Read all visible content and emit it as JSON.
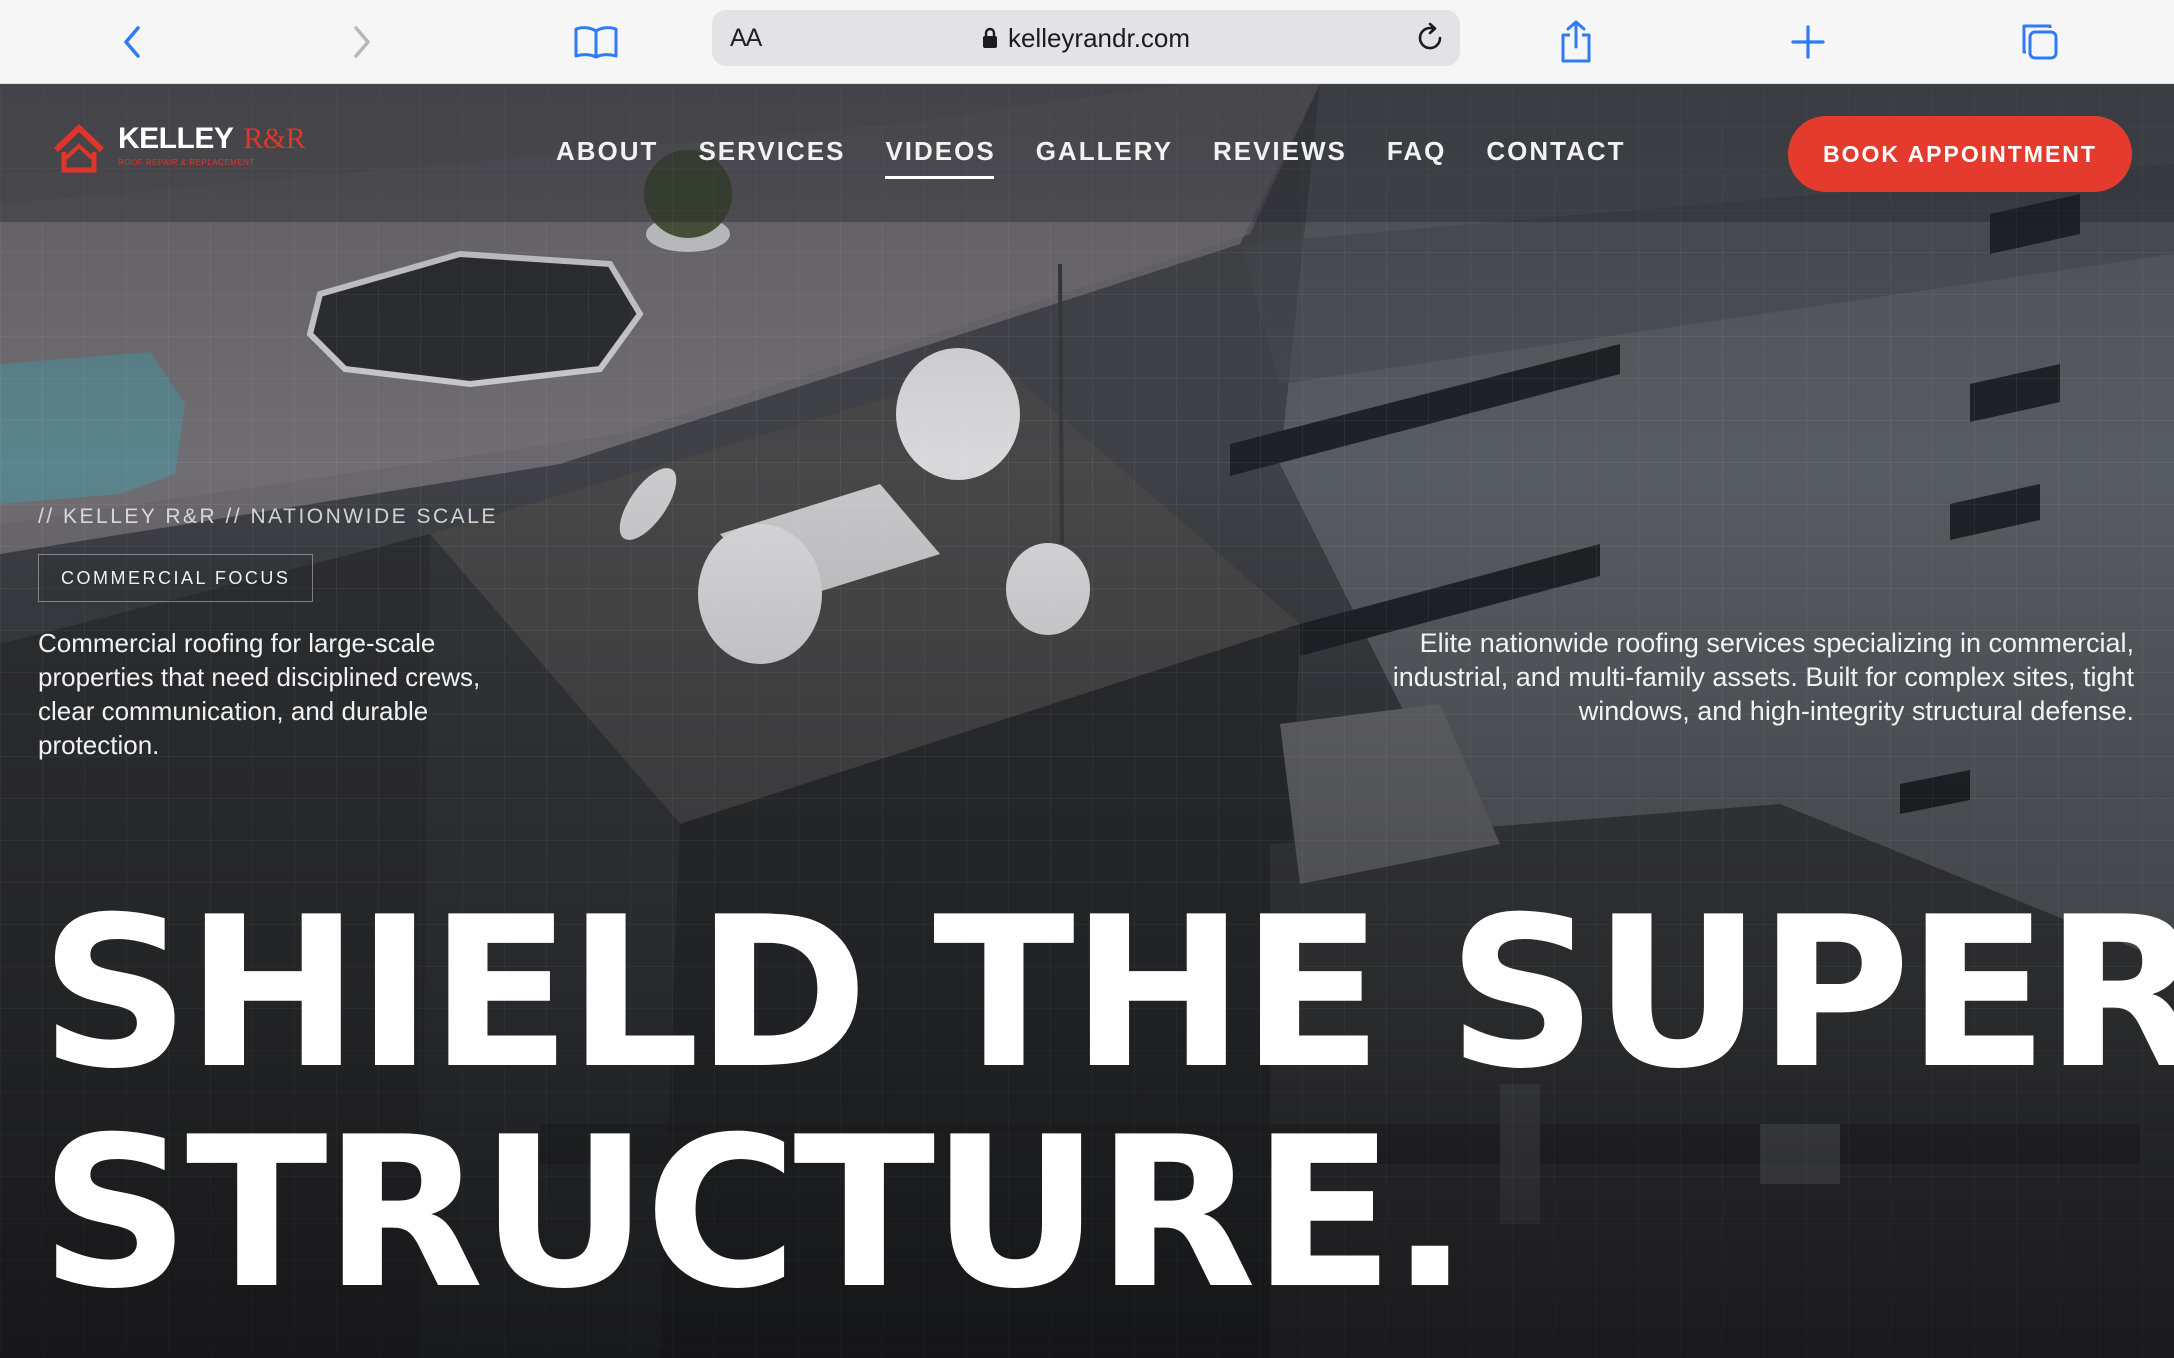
{
  "browser": {
    "reader_label": "AA",
    "url": "kelleyrandr.com",
    "icons": {
      "back": "chevron-left-icon",
      "forward": "chevron-right-icon",
      "bookmarks": "book-icon",
      "lock": "lock-icon",
      "reload": "reload-icon",
      "share": "share-icon",
      "new_tab": "plus-icon",
      "tabs": "tabs-icon"
    }
  },
  "site": {
    "logo": {
      "name": "KELLEY",
      "accent": "R&R",
      "tagline": "ROOF REPAIR & REPLACEMENT"
    },
    "nav": [
      {
        "label": "ABOUT",
        "active": false
      },
      {
        "label": "SERVICES",
        "active": false
      },
      {
        "label": "VIDEOS",
        "active": true
      },
      {
        "label": "GALLERY",
        "active": false
      },
      {
        "label": "REVIEWS",
        "active": false
      },
      {
        "label": "FAQ",
        "active": false
      },
      {
        "label": "CONTACT",
        "active": false
      }
    ],
    "cta": "BOOK APPOINTMENT",
    "colors": {
      "accent": "#e53a2e",
      "text": "#ffffff"
    }
  },
  "hero": {
    "eyebrow": "// KELLEY R&R // NATIONWIDE SCALE",
    "tag": "COMMERCIAL FOCUS",
    "lead_left": "Commercial roofing for large-scale properties that need disciplined crews, clear communication, and durable protection.",
    "lead_right": "Elite nationwide roofing services specializing in commercial, industrial, and multi-family assets. Built for complex sites, tight windows, and high-integrity structural defense.",
    "headline_line1": "SHIELD THE SUPER",
    "headline_line2": "STRUCTURE."
  }
}
